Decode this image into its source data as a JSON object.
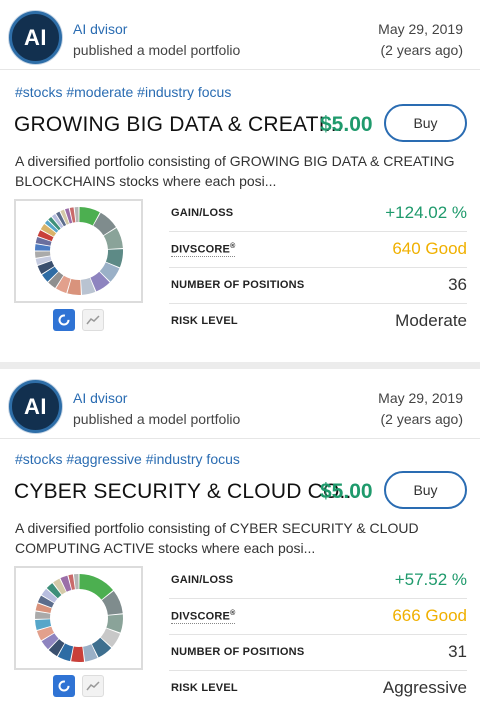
{
  "portfolios": [
    {
      "author_initials": "AI",
      "author_name": "AI dvisor",
      "action": "published a model portfolio",
      "date": "May 29, 2019",
      "ago": "(2 years ago)",
      "tags": "#stocks #moderate #industry focus",
      "title": "GROWING BIG DATA & CREATI...",
      "price": "$5.00",
      "buy_label": "Buy",
      "description": "A diversified portfolio consisting of GROWING BIG DATA & CREATING BLOCKCHAINS stocks where each posi...",
      "stats": {
        "gain_label": "GAIN/LOSS",
        "gain_value": "+124.02 %",
        "divscore_label": "DIVSCORE",
        "divscore_mark": "®",
        "divscore_value": "640 Good",
        "positions_label": "NUMBER OF POSITIONS",
        "positions_value": "36",
        "risk_label": "RISK LEVEL",
        "risk_value": "Moderate"
      },
      "donut_slices": [
        {
          "value": 9,
          "color": "#4caf50"
        },
        {
          "value": 9,
          "color": "#7f8c8d"
        },
        {
          "value": 9,
          "color": "#8aa399"
        },
        {
          "value": 8,
          "color": "#5d8a86"
        },
        {
          "value": 7,
          "color": "#9ab0c7"
        },
        {
          "value": 7,
          "color": "#8e84bf"
        },
        {
          "value": 6,
          "color": "#b9c3d1"
        },
        {
          "value": 6,
          "color": "#d9937c"
        },
        {
          "value": 5,
          "color": "#e2a08c"
        },
        {
          "value": 4,
          "color": "#8f8f8f"
        },
        {
          "value": 4,
          "color": "#2e6ca4"
        },
        {
          "value": 4,
          "color": "#3a4f6e"
        },
        {
          "value": 3,
          "color": "#c5cbe0"
        },
        {
          "value": 3,
          "color": "#aaaaaa"
        },
        {
          "value": 3,
          "color": "#4d7cc3"
        },
        {
          "value": 3,
          "color": "#6b6f9e"
        },
        {
          "value": 3,
          "color": "#c9403a"
        },
        {
          "value": 3,
          "color": "#d9b36a"
        },
        {
          "value": 2,
          "color": "#56a6c9"
        },
        {
          "value": 2,
          "color": "#3e8f7a"
        },
        {
          "value": 2,
          "color": "#b8bedf"
        },
        {
          "value": 2,
          "color": "#5c6d8c"
        },
        {
          "value": 2,
          "color": "#d4c9a8"
        },
        {
          "value": 2,
          "color": "#9b6ea8"
        },
        {
          "value": 2,
          "color": "#c96a6a"
        },
        {
          "value": 2,
          "color": "#b5b5b5"
        }
      ]
    },
    {
      "author_initials": "AI",
      "author_name": "AI dvisor",
      "action": "published a model portfolio",
      "date": "May 29, 2019",
      "ago": "(2 years ago)",
      "tags": "#stocks #aggressive #industry focus",
      "title": "CYBER SECURITY & CLOUD CO...",
      "price": "$5.00",
      "buy_label": "Buy",
      "description": "A diversified portfolio consisting of CYBER SECURITY & CLOUD COMPUTING ACTIVE stocks where each posi...",
      "stats": {
        "gain_label": "GAIN/LOSS",
        "gain_value": "+57.52 %",
        "divscore_label": "DIVSCORE",
        "divscore_mark": "®",
        "divscore_value": "666 Good",
        "positions_label": "NUMBER OF POSITIONS",
        "positions_value": "31",
        "risk_label": "RISK LEVEL",
        "risk_value": "Aggressive"
      },
      "donut_slices": [
        {
          "value": 14,
          "color": "#4caf50"
        },
        {
          "value": 9,
          "color": "#7f8c8d"
        },
        {
          "value": 7,
          "color": "#8aa399"
        },
        {
          "value": 6,
          "color": "#c8c8c8"
        },
        {
          "value": 6,
          "color": "#3e6f8f"
        },
        {
          "value": 5,
          "color": "#9ab0c7"
        },
        {
          "value": 5,
          "color": "#c9403a"
        },
        {
          "value": 5,
          "color": "#2e6ca4"
        },
        {
          "value": 4,
          "color": "#3a4f6e"
        },
        {
          "value": 4,
          "color": "#8e84bf"
        },
        {
          "value": 4,
          "color": "#e2a08c"
        },
        {
          "value": 4,
          "color": "#56a6c9"
        },
        {
          "value": 3,
          "color": "#aaaaaa"
        },
        {
          "value": 3,
          "color": "#d9937c"
        },
        {
          "value": 3,
          "color": "#5c6d8c"
        },
        {
          "value": 3,
          "color": "#b8bedf"
        },
        {
          "value": 3,
          "color": "#3e8f7a"
        },
        {
          "value": 3,
          "color": "#d4c9a8"
        },
        {
          "value": 3,
          "color": "#9b6ea8"
        },
        {
          "value": 2,
          "color": "#c96a6a"
        },
        {
          "value": 2,
          "color": "#b5b5b5"
        }
      ]
    }
  ]
}
